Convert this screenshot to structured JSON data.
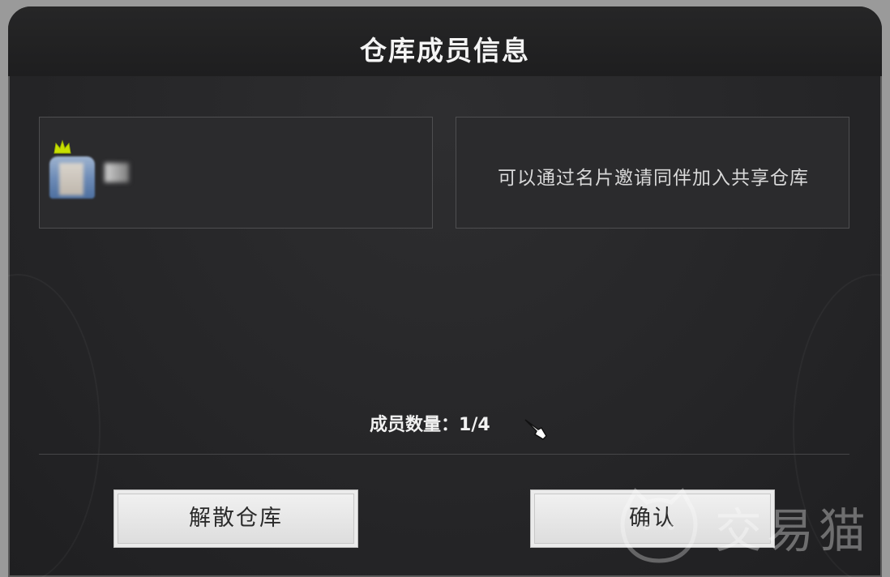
{
  "dialog": {
    "title": "仓库成员信息",
    "invite_hint": "可以通过名片邀请同伴加入共享仓库",
    "member_count_label": "成员数量：",
    "member_count_value": "1/4",
    "buttons": {
      "dissolve": "解散仓库",
      "confirm": "确认"
    }
  },
  "watermark": {
    "text": "交易猫"
  },
  "colors": {
    "panel_bg": "#262628",
    "card_bg": "#2b2b2d",
    "button_bg": "#eeeeee",
    "crown": "#c8e000"
  }
}
